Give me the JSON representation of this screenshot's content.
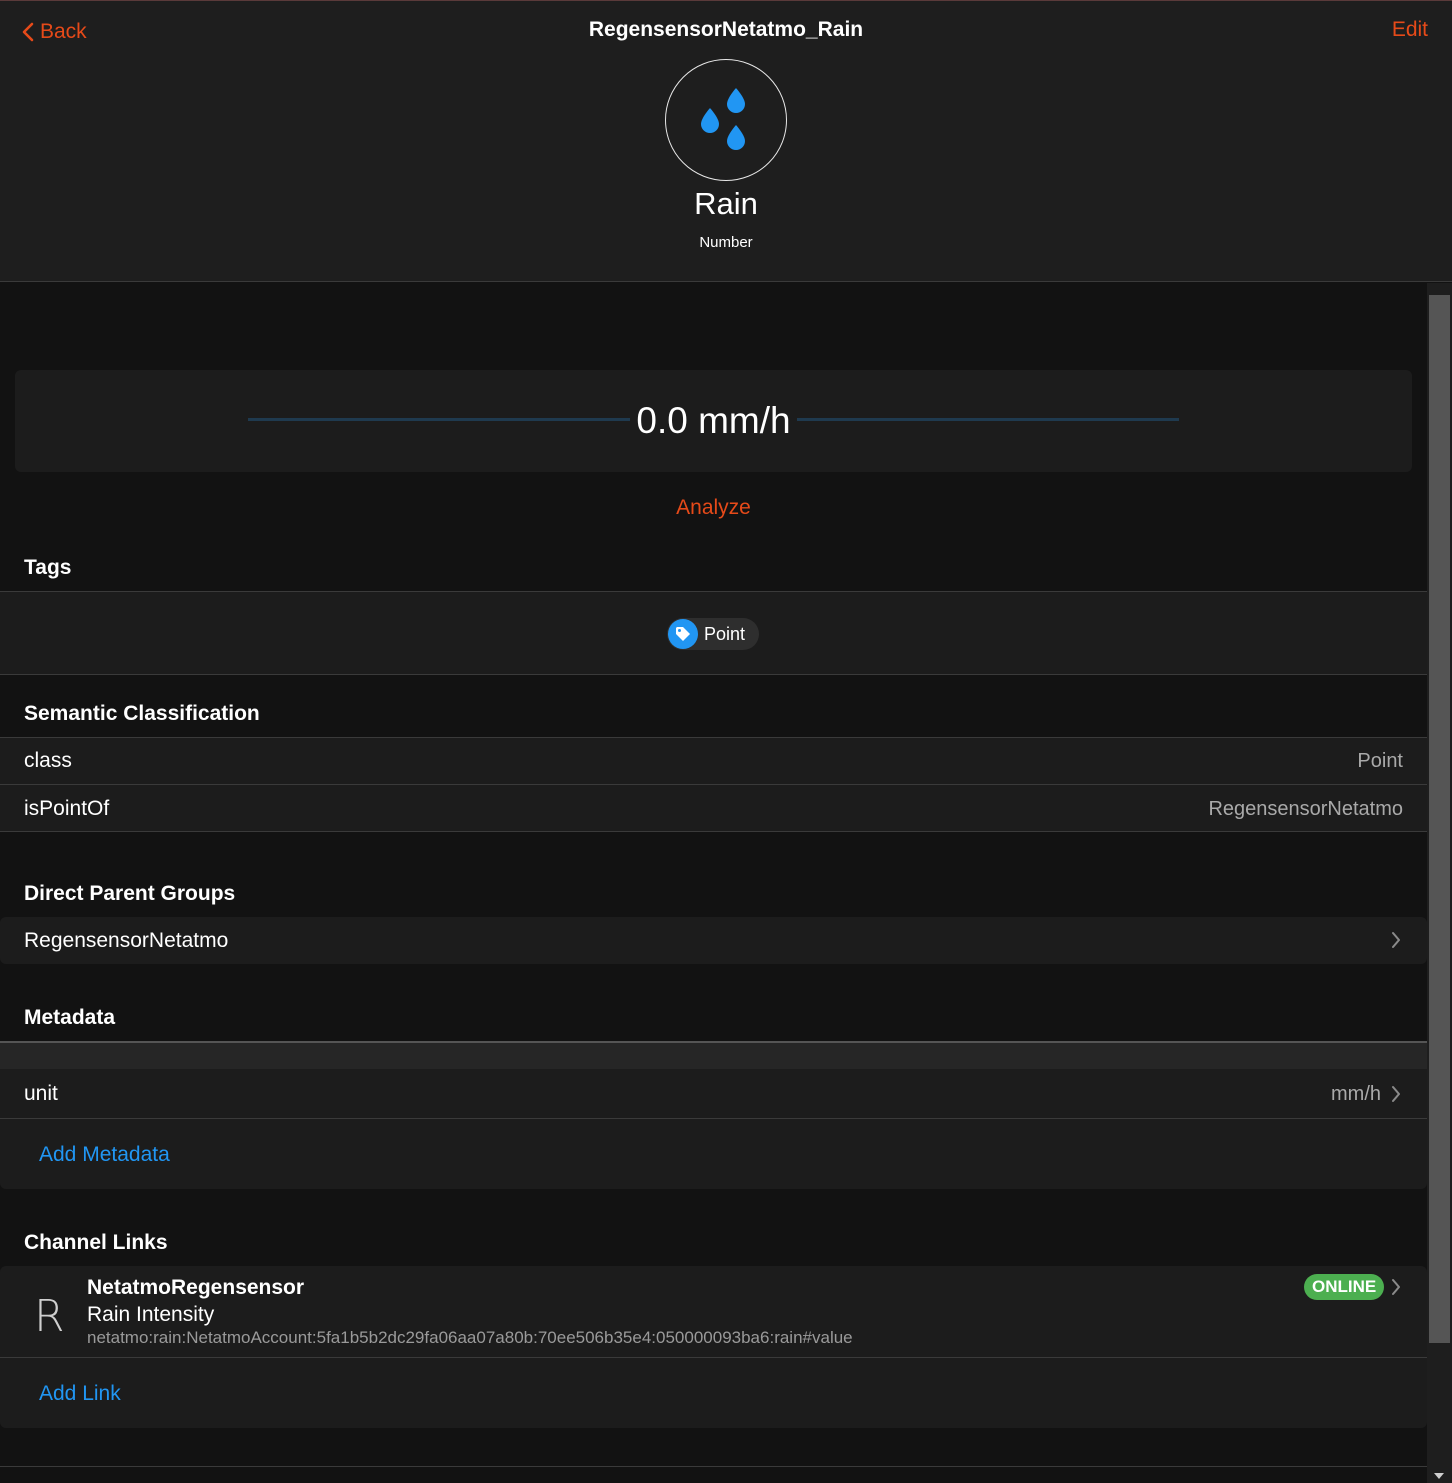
{
  "nav": {
    "back_label": "Back",
    "title": "RegensensorNetatmo_Rain",
    "edit_label": "Edit"
  },
  "item": {
    "label": "Rain",
    "type": "Number",
    "icon": "raindrops-icon",
    "icon_color": "#2196f3"
  },
  "state": {
    "value": "0.0 mm/h"
  },
  "analyze_label": "Analyze",
  "tags": {
    "title": "Tags",
    "items": [
      "Point"
    ]
  },
  "semantic": {
    "title": "Semantic Classification",
    "rows": [
      {
        "label": "class",
        "value": "Point"
      },
      {
        "label": "isPointOf",
        "value": "RegensensorNetatmo"
      }
    ]
  },
  "parent_groups": {
    "title": "Direct Parent Groups",
    "items": [
      "RegensensorNetatmo"
    ]
  },
  "metadata": {
    "title": "Metadata",
    "rows": [
      {
        "label": "unit",
        "value": "mm/h"
      }
    ],
    "add_label": "Add Metadata"
  },
  "channel_links": {
    "title": "Channel Links",
    "items": [
      {
        "avatar": "R",
        "title": "NetatmoRegensensor",
        "subtitle": "Rain Intensity",
        "uid": "netatmo:rain:NetatmoAccount:5fa1b5b2dc29fa06aa07a80b:70ee506b35e4:050000093ba6:rain#value",
        "status": "ONLINE"
      }
    ],
    "add_label": "Add Link"
  },
  "colors": {
    "accent": "#e64a19",
    "link": "#2196f3",
    "online": "#4caf50"
  }
}
